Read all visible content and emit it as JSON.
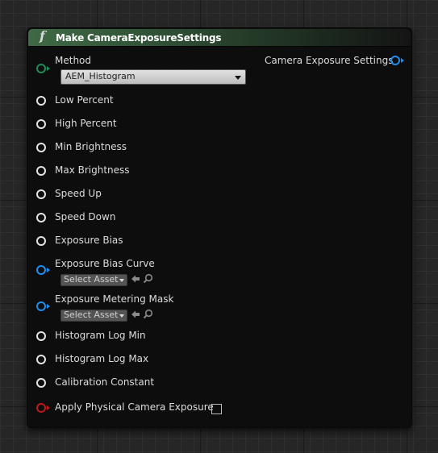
{
  "node": {
    "title": "Make CameraExposureSettings",
    "icon": "function-icon",
    "output_label": "Camera Exposure Settings",
    "method": {
      "label": "Method",
      "value": "AEM_Histogram"
    },
    "inputs": [
      "Low Percent",
      "High Percent",
      "Min Brightness",
      "Max Brightness",
      "Speed Up",
      "Speed Down",
      "Exposure Bias"
    ],
    "bias_curve": {
      "label": "Exposure Bias Curve",
      "asset": "Select Asset"
    },
    "metering_mask": {
      "label": "Exposure Metering Mask",
      "asset": "Select Asset"
    },
    "inputs2": [
      "Histogram Log Min",
      "Histogram Log Max",
      "Calibration Constant"
    ],
    "physical": {
      "label": "Apply Physical Camera Exposure",
      "checked": false
    }
  },
  "colors": {
    "header_green": "#3f6a45",
    "pin_struct": "#1e8ef0",
    "pin_enum": "#1f8a5a",
    "pin_bool": "#c01818"
  }
}
